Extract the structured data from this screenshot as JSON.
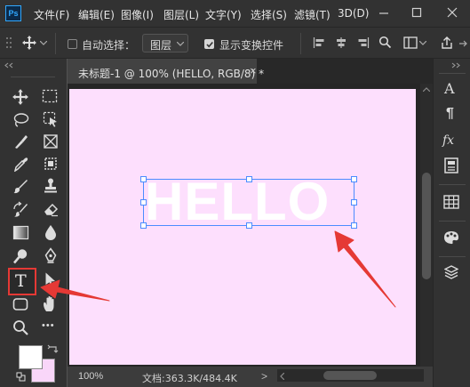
{
  "app": {
    "logo": "Ps"
  },
  "menu": [
    "文件(F)",
    "编辑(E)",
    "图像(I)",
    "图层(L)",
    "文字(Y)",
    "选择(S)",
    "滤镜(T)",
    "3D(D)"
  ],
  "options": {
    "auto_select_label": "自动选择：",
    "layer_value": "图层",
    "show_transform_label": "显示变换控件",
    "auto_select_checked": false,
    "show_transform_checked": true
  },
  "document": {
    "tab_title": "未标题-1 @ 100% (HELLO, RGB/8) *",
    "close_glyph": "×",
    "canvas_text": "HELLO",
    "canvas_color": "#fddffd",
    "text_color": "#ffffff"
  },
  "status": {
    "zoom": "100%",
    "doc_info": "文档:363.3K/484.4K",
    "nav_glyph": ">"
  },
  "colors": {
    "foreground": "#ffffff",
    "background": "#f9d6f9",
    "accent": "#31a8ff",
    "highlight": "#e53935"
  },
  "icons": {
    "more": "•••",
    "fx": "fx",
    "type_tool": "T",
    "char_A": "A",
    "para": "¶"
  }
}
